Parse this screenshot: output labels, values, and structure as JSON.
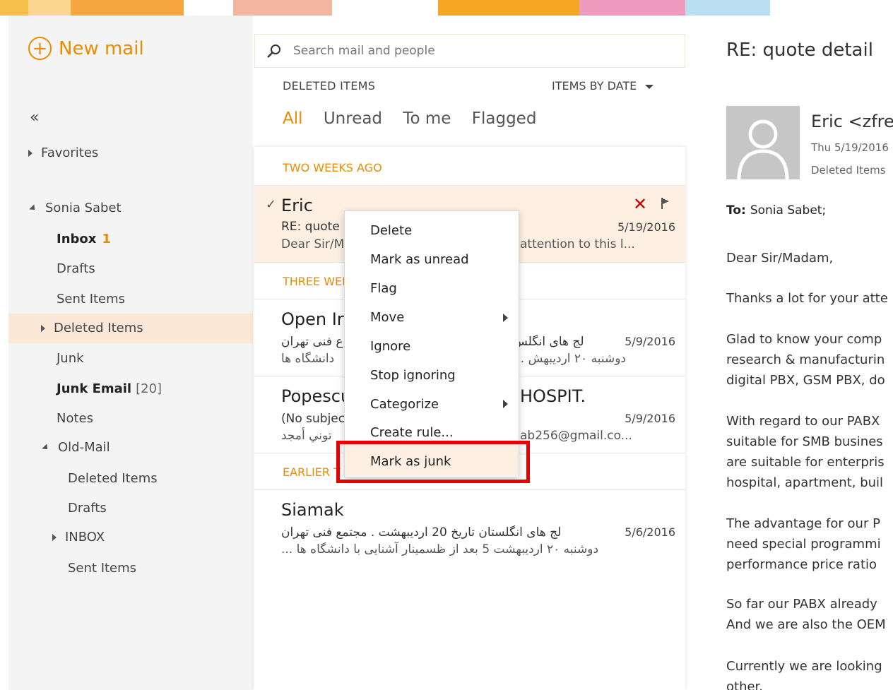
{
  "compose": {
    "label": "New mail"
  },
  "nav": {
    "collapse_glyph": "«",
    "favorites": "Favorites",
    "account": "Sonia Sabet",
    "folders": {
      "inbox": "Inbox",
      "inbox_count": "1",
      "drafts": "Drafts",
      "sent": "Sent Items",
      "deleted": "Deleted Items",
      "junk": "Junk",
      "junk_email": "Junk Email",
      "junk_email_count": "[20]",
      "notes": "Notes",
      "old_mail": "Old-Mail",
      "old_deleted": "Deleted Items",
      "old_drafts": "Drafts",
      "old_inbox": "INBOX",
      "old_sent": "Sent Items"
    }
  },
  "search": {
    "placeholder": "Search mail and people"
  },
  "list": {
    "folder_title": "DELETED ITEMS",
    "sort_label": "ITEMS BY DATE",
    "filters": [
      "All",
      "Unread",
      "To me",
      "Flagged"
    ],
    "groups": {
      "two_weeks": "TWO WEEKS AGO",
      "three_weeks": "THREE WEE",
      "earlier": "EARLIER T"
    },
    "items": [
      {
        "sender": "Eric",
        "subject": "RE: quote",
        "date": "5/19/2016",
        "preview_left": "Dear Sir/M",
        "preview_right": "attention to this l..."
      },
      {
        "sender": "Open Ir",
        "subject_right": "لج های انگلس",
        "subject_left": "ع فنی تهران",
        "date": "5/9/2016",
        "preview_right": "... دوشنبه ۲۰ اردیبهش",
        "preview_left": "دانشگاه ها"
      },
      {
        "sender": "Popescu",
        "sender_right": "HOSPIT.",
        "subject": "(No subjec",
        "date": "5/9/2016",
        "preview_left": "توني أمجد",
        "preview_right": "ab256@gmail.co..."
      },
      {
        "sender": "Siamak",
        "subject": "لج های انگلستان تاریخ 20 اردیبهشت . مجتمع فنی تهران",
        "date": "5/6/2016",
        "preview": "... دوشنبه ۲۰ اردیبهشت 5 بعد از ظسمینار آشنایی با دانشگاه ها"
      }
    ]
  },
  "context_menu": {
    "items": [
      "Delete",
      "Mark as unread",
      "Flag",
      "Move",
      "Ignore",
      "Stop ignoring",
      "Categorize",
      "Create rule...",
      "Mark as junk"
    ]
  },
  "reading": {
    "title": "RE: quote detail",
    "from": "Eric <zfre",
    "date": "Thu 5/19/2016",
    "folder": "Deleted Items",
    "to_label": "To:",
    "to": "Sonia Sabet;",
    "body": [
      [
        "Dear Sir/Madam,"
      ],
      [
        "Thanks a lot for your atte"
      ],
      [
        "Glad to know your comp",
        "research & manufacturin",
        "digital PBX, GSM PBX, do"
      ],
      [
        "With regard to our PABX",
        "suitable for SMB busines",
        "are suitable for enterpris",
        "hospital, apartment, buil"
      ],
      [
        "The advantage for our P",
        "need special programmi",
        "performance price ratio"
      ],
      [
        "So far our PABX already",
        "And we are also the OEM"
      ],
      [
        "Currently we are looking",
        "other."
      ]
    ]
  },
  "colors": {
    "accent": "#ea8c00",
    "selection": "#fce8d6",
    "highlight_box": "#e80000",
    "delete_x": "#c00000"
  }
}
